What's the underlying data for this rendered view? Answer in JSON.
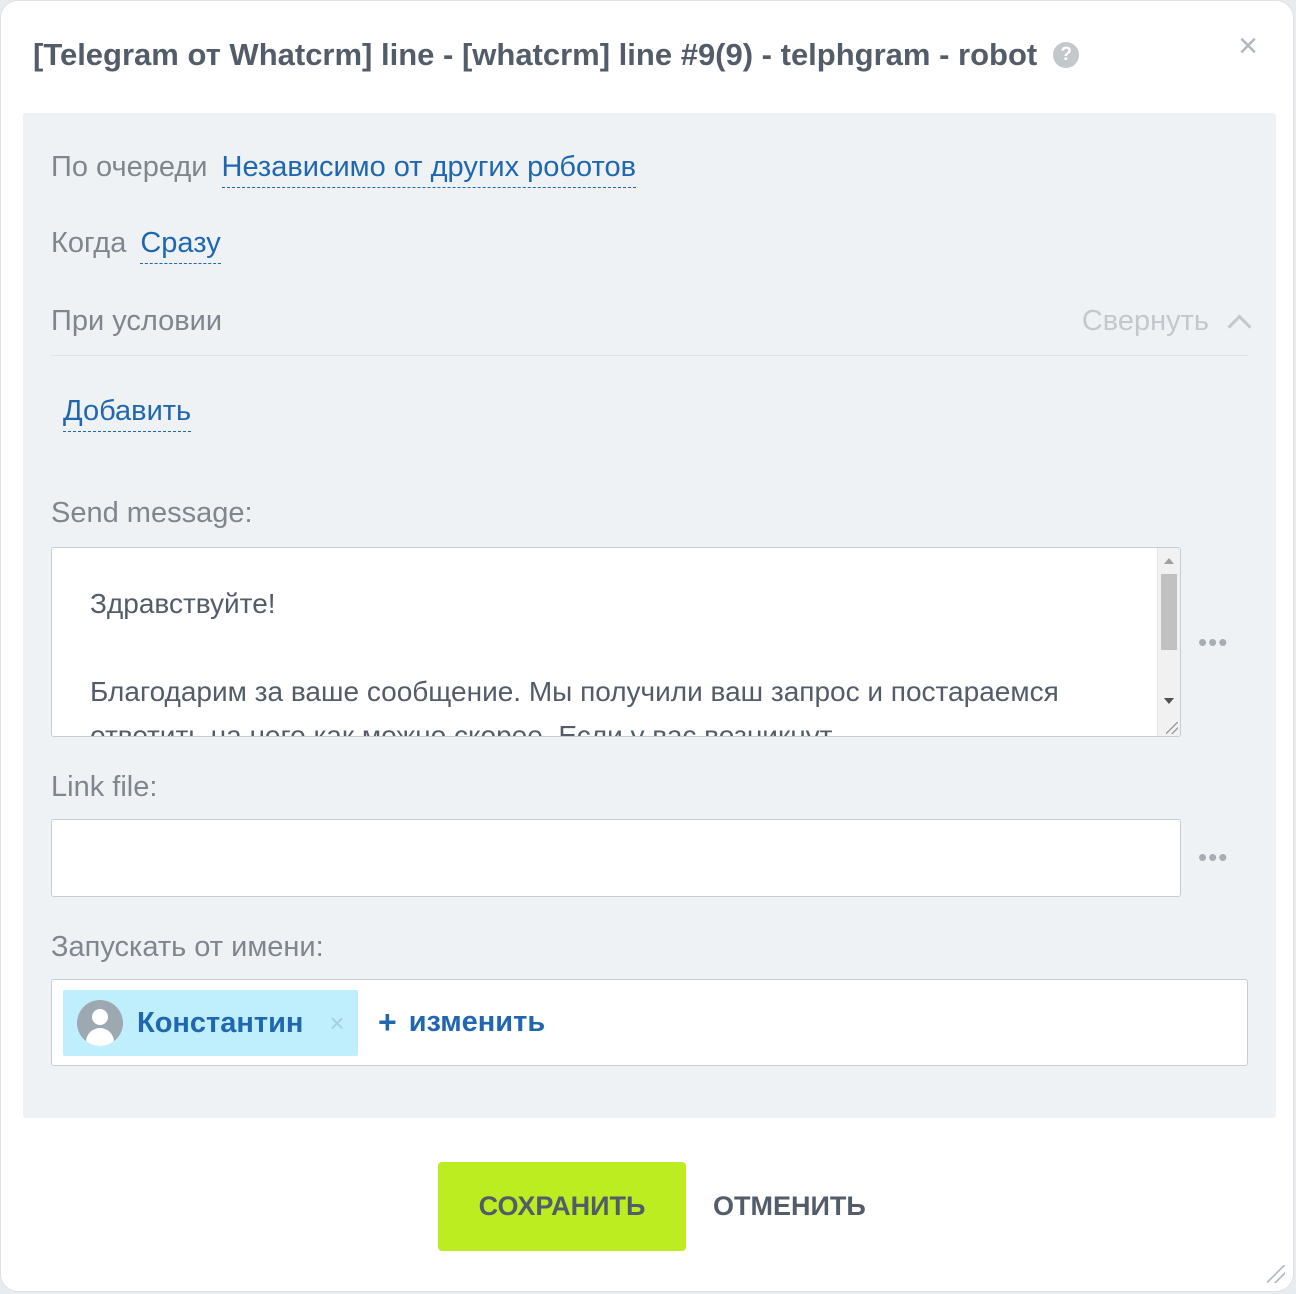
{
  "dialog": {
    "title": "[Telegram от Whatcrm] line - [whatcrm] line #9(9) - telphgram - robot",
    "help_glyph": "?",
    "close_glyph": "×"
  },
  "settings": {
    "queue_label": "По очереди",
    "queue_value": "Независимо от других роботов",
    "when_label": "Когда",
    "when_value": "Сразу",
    "condition_label": "При условии",
    "collapse_label": "Свернуть",
    "add_label": "Добавить"
  },
  "message": {
    "label": "Send message:",
    "text": "Здравствуйте!\n\nБлагодарим за ваше сообщение. Мы получили ваш запрос и постараемся ответить на него как можно скорее. Если у вас возникнут"
  },
  "link_file": {
    "label": "Link file:",
    "value": ""
  },
  "run_as": {
    "label": "Запускать от имени:",
    "user_name": "Константин",
    "remove_glyph": "×",
    "change_plus": "+",
    "change_label": "изменить"
  },
  "more_glyph": "•••",
  "buttons": {
    "save": "СОХРАНИТЬ",
    "cancel": "ОТМЕНИТЬ"
  },
  "colors": {
    "link": "#2067b0",
    "save_button": "#bbed21",
    "panel": "#eef2f4",
    "user_tag": "#bfeffd"
  }
}
